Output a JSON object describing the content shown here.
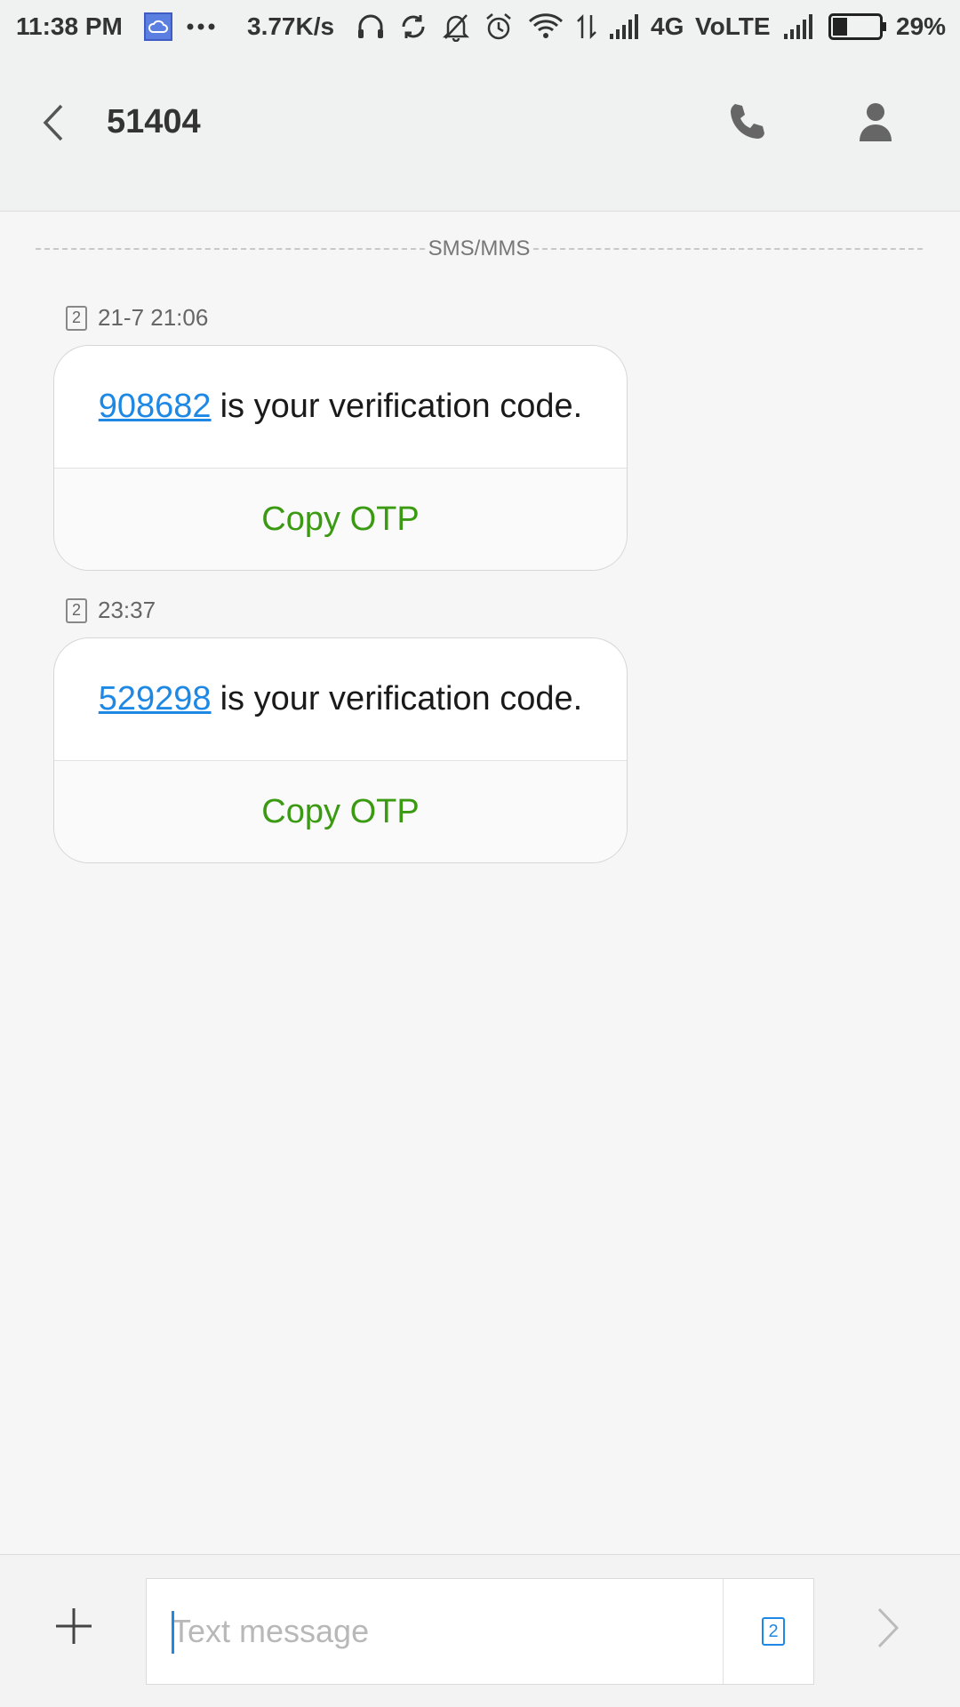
{
  "status_bar": {
    "time": "11:38 PM",
    "network_speed": "3.77K/s",
    "network_type": "4G",
    "volte": "VoLTE",
    "battery_percent": "29%",
    "battery_level": 0.29,
    "icons": [
      "cloud-icon",
      "more-dots-icon",
      "headset-icon",
      "sync-icon",
      "mute-bell-icon",
      "alarm-icon",
      "wifi-icon",
      "data-arrows-icon",
      "signal-icon",
      "signal-icon",
      "battery-icon"
    ]
  },
  "header": {
    "title": "51404",
    "icons": [
      "back-arrow-icon",
      "phone-icon",
      "person-icon"
    ]
  },
  "thread": {
    "divider_label": "SMS/MMS",
    "messages": [
      {
        "sim": "2",
        "timestamp": "21-7 21:06",
        "code": "908682",
        "text": "is your verification code.",
        "action": "Copy OTP"
      },
      {
        "sim": "2",
        "timestamp": "23:37",
        "code": "529298",
        "text": "is your verification code.",
        "action": "Copy OTP"
      }
    ]
  },
  "composer": {
    "placeholder": "Text message",
    "sim": "2",
    "icons": [
      "plus-icon",
      "sim-card-icon",
      "send-arrow-icon"
    ]
  },
  "colors": {
    "link": "#1e88e5",
    "action": "#3a9a12",
    "background": "#f6f6f6",
    "header": "#f0f1f1"
  }
}
